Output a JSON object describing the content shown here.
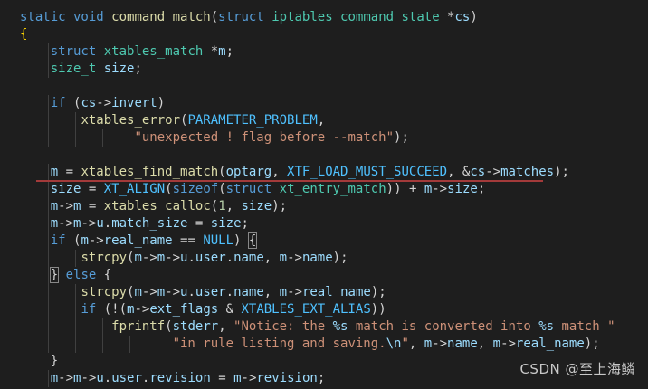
{
  "editor": {
    "language": "c",
    "theme": "dark",
    "colors": {
      "background": "#1e1e1e",
      "keyword": "#569cd6",
      "type": "#4ec9b0",
      "function": "#dcdcaa",
      "variable": "#9cdcfe",
      "string": "#ce9178",
      "number": "#b5cea8",
      "macro": "#4fc1ff",
      "bracket": "#ffd700",
      "annotation_underline": "#a33a3a"
    },
    "lines": [
      [
        [
          "kw",
          "static"
        ],
        [
          "kw",
          " void "
        ],
        [
          "fn",
          "command_match"
        ],
        [
          "op",
          "("
        ],
        [
          "kw",
          "struct "
        ],
        [
          "ty",
          "iptables_command_state"
        ],
        [
          "op",
          " *"
        ],
        [
          "va",
          "cs"
        ],
        [
          "op",
          ")"
        ]
      ],
      [
        [
          "br",
          "{"
        ]
      ],
      [
        [
          "op",
          "    "
        ],
        [
          "kw",
          "struct "
        ],
        [
          "ty",
          "xtables_match"
        ],
        [
          "op",
          " *"
        ],
        [
          "va",
          "m"
        ],
        [
          "op",
          ";"
        ]
      ],
      [
        [
          "op",
          "    "
        ],
        [
          "ty",
          "size_t"
        ],
        [
          "op",
          " "
        ],
        [
          "va",
          "size"
        ],
        [
          "op",
          ";"
        ]
      ],
      [],
      [
        [
          "op",
          "    "
        ],
        [
          "kw",
          "if"
        ],
        [
          "op",
          " ("
        ],
        [
          "va",
          "cs"
        ],
        [
          "op",
          "->"
        ],
        [
          "va",
          "invert"
        ],
        [
          "op",
          ")"
        ]
      ],
      [
        [
          "op",
          "        "
        ],
        [
          "fn",
          "xtables_error"
        ],
        [
          "op",
          "("
        ],
        [
          "mac",
          "PARAMETER_PROBLEM"
        ],
        [
          "op",
          ","
        ]
      ],
      [
        [
          "op",
          "               "
        ],
        [
          "str",
          "\"unexpected ! flag before --match\""
        ],
        [
          "op",
          ");"
        ]
      ],
      [],
      [
        [
          "op",
          "    "
        ],
        [
          "va",
          "m"
        ],
        [
          "op",
          " = "
        ],
        [
          "fn",
          "xtables_find_match"
        ],
        [
          "op",
          "("
        ],
        [
          "va",
          "optarg"
        ],
        [
          "op",
          ", "
        ],
        [
          "mac",
          "XTF_LOAD_MUST_SUCCEED"
        ],
        [
          "op",
          ", &"
        ],
        [
          "va",
          "cs"
        ],
        [
          "op",
          "->"
        ],
        [
          "va",
          "matches"
        ],
        [
          "op",
          ");"
        ]
      ],
      [
        [
          "op",
          "    "
        ],
        [
          "va",
          "size"
        ],
        [
          "op",
          " = "
        ],
        [
          "mac",
          "XT_ALIGN"
        ],
        [
          "op",
          "("
        ],
        [
          "kw",
          "sizeof"
        ],
        [
          "op",
          "("
        ],
        [
          "kw",
          "struct "
        ],
        [
          "ty",
          "xt_entry_match"
        ],
        [
          "op",
          ")) + "
        ],
        [
          "va",
          "m"
        ],
        [
          "op",
          "->"
        ],
        [
          "va",
          "size"
        ],
        [
          "op",
          ";"
        ]
      ],
      [
        [
          "op",
          "    "
        ],
        [
          "va",
          "m"
        ],
        [
          "op",
          "->"
        ],
        [
          "va",
          "m"
        ],
        [
          "op",
          " = "
        ],
        [
          "fn",
          "xtables_calloc"
        ],
        [
          "op",
          "("
        ],
        [
          "num",
          "1"
        ],
        [
          "op",
          ", "
        ],
        [
          "va",
          "size"
        ],
        [
          "op",
          ");"
        ]
      ],
      [
        [
          "op",
          "    "
        ],
        [
          "va",
          "m"
        ],
        [
          "op",
          "->"
        ],
        [
          "va",
          "m"
        ],
        [
          "op",
          "->"
        ],
        [
          "va",
          "u"
        ],
        [
          "op",
          "."
        ],
        [
          "va",
          "match_size"
        ],
        [
          "op",
          " = "
        ],
        [
          "va",
          "size"
        ],
        [
          "op",
          ";"
        ]
      ],
      [
        [
          "op",
          "    "
        ],
        [
          "kw",
          "if"
        ],
        [
          "op",
          " ("
        ],
        [
          "va",
          "m"
        ],
        [
          "op",
          "->"
        ],
        [
          "va",
          "real_name"
        ],
        [
          "op",
          " == "
        ],
        [
          "mac",
          "NULL"
        ],
        [
          "op",
          ") "
        ],
        [
          "bm",
          "{"
        ]
      ],
      [
        [
          "op",
          "        "
        ],
        [
          "fn",
          "strcpy"
        ],
        [
          "op",
          "("
        ],
        [
          "va",
          "m"
        ],
        [
          "op",
          "->"
        ],
        [
          "va",
          "m"
        ],
        [
          "op",
          "->"
        ],
        [
          "va",
          "u"
        ],
        [
          "op",
          "."
        ],
        [
          "va",
          "user"
        ],
        [
          "op",
          "."
        ],
        [
          "va",
          "name"
        ],
        [
          "op",
          ", "
        ],
        [
          "va",
          "m"
        ],
        [
          "op",
          "->"
        ],
        [
          "va",
          "name"
        ],
        [
          "op",
          ");"
        ]
      ],
      [
        [
          "op",
          "    "
        ],
        [
          "bm",
          "}"
        ],
        [
          "op",
          " "
        ],
        [
          "kw",
          "else"
        ],
        [
          "op",
          " {"
        ]
      ],
      [
        [
          "op",
          "        "
        ],
        [
          "fn",
          "strcpy"
        ],
        [
          "op",
          "("
        ],
        [
          "va",
          "m"
        ],
        [
          "op",
          "->"
        ],
        [
          "va",
          "m"
        ],
        [
          "op",
          "->"
        ],
        [
          "va",
          "u"
        ],
        [
          "op",
          "."
        ],
        [
          "va",
          "user"
        ],
        [
          "op",
          "."
        ],
        [
          "va",
          "name"
        ],
        [
          "op",
          ", "
        ],
        [
          "va",
          "m"
        ],
        [
          "op",
          "->"
        ],
        [
          "va",
          "real_name"
        ],
        [
          "op",
          ");"
        ]
      ],
      [
        [
          "op",
          "        "
        ],
        [
          "kw",
          "if"
        ],
        [
          "op",
          " (!("
        ],
        [
          "va",
          "m"
        ],
        [
          "op",
          "->"
        ],
        [
          "va",
          "ext_flags"
        ],
        [
          "op",
          " & "
        ],
        [
          "mac",
          "XTABLES_EXT_ALIAS"
        ],
        [
          "op",
          "))"
        ]
      ],
      [
        [
          "op",
          "            "
        ],
        [
          "fn",
          "fprintf"
        ],
        [
          "op",
          "("
        ],
        [
          "va",
          "stderr"
        ],
        [
          "op",
          ", "
        ],
        [
          "str",
          "\"Notice: the "
        ],
        [
          "fmt",
          "%s"
        ],
        [
          "str",
          " match is converted into "
        ],
        [
          "fmt",
          "%s"
        ],
        [
          "str",
          " match \""
        ]
      ],
      [
        [
          "op",
          "                    "
        ],
        [
          "str",
          "\"in rule listing and saving."
        ],
        [
          "fmt",
          "\\n"
        ],
        [
          "str",
          "\""
        ],
        [
          "op",
          ", "
        ],
        [
          "va",
          "m"
        ],
        [
          "op",
          "->"
        ],
        [
          "va",
          "name"
        ],
        [
          "op",
          ", "
        ],
        [
          "va",
          "m"
        ],
        [
          "op",
          "->"
        ],
        [
          "va",
          "real_name"
        ],
        [
          "op",
          ");"
        ]
      ],
      [
        [
          "op",
          "    }"
        ]
      ],
      [
        [
          "op",
          "    "
        ],
        [
          "va",
          "m"
        ],
        [
          "op",
          "->"
        ],
        [
          "va",
          "m"
        ],
        [
          "op",
          "->"
        ],
        [
          "va",
          "u"
        ],
        [
          "op",
          "."
        ],
        [
          "va",
          "user"
        ],
        [
          "op",
          "."
        ],
        [
          "va",
          "revision"
        ],
        [
          "op",
          " = "
        ],
        [
          "va",
          "m"
        ],
        [
          "op",
          "->"
        ],
        [
          "va",
          "revision"
        ],
        [
          "op",
          ";"
        ]
      ]
    ]
  },
  "watermark": {
    "text": "CSDN @至上海鳞"
  }
}
